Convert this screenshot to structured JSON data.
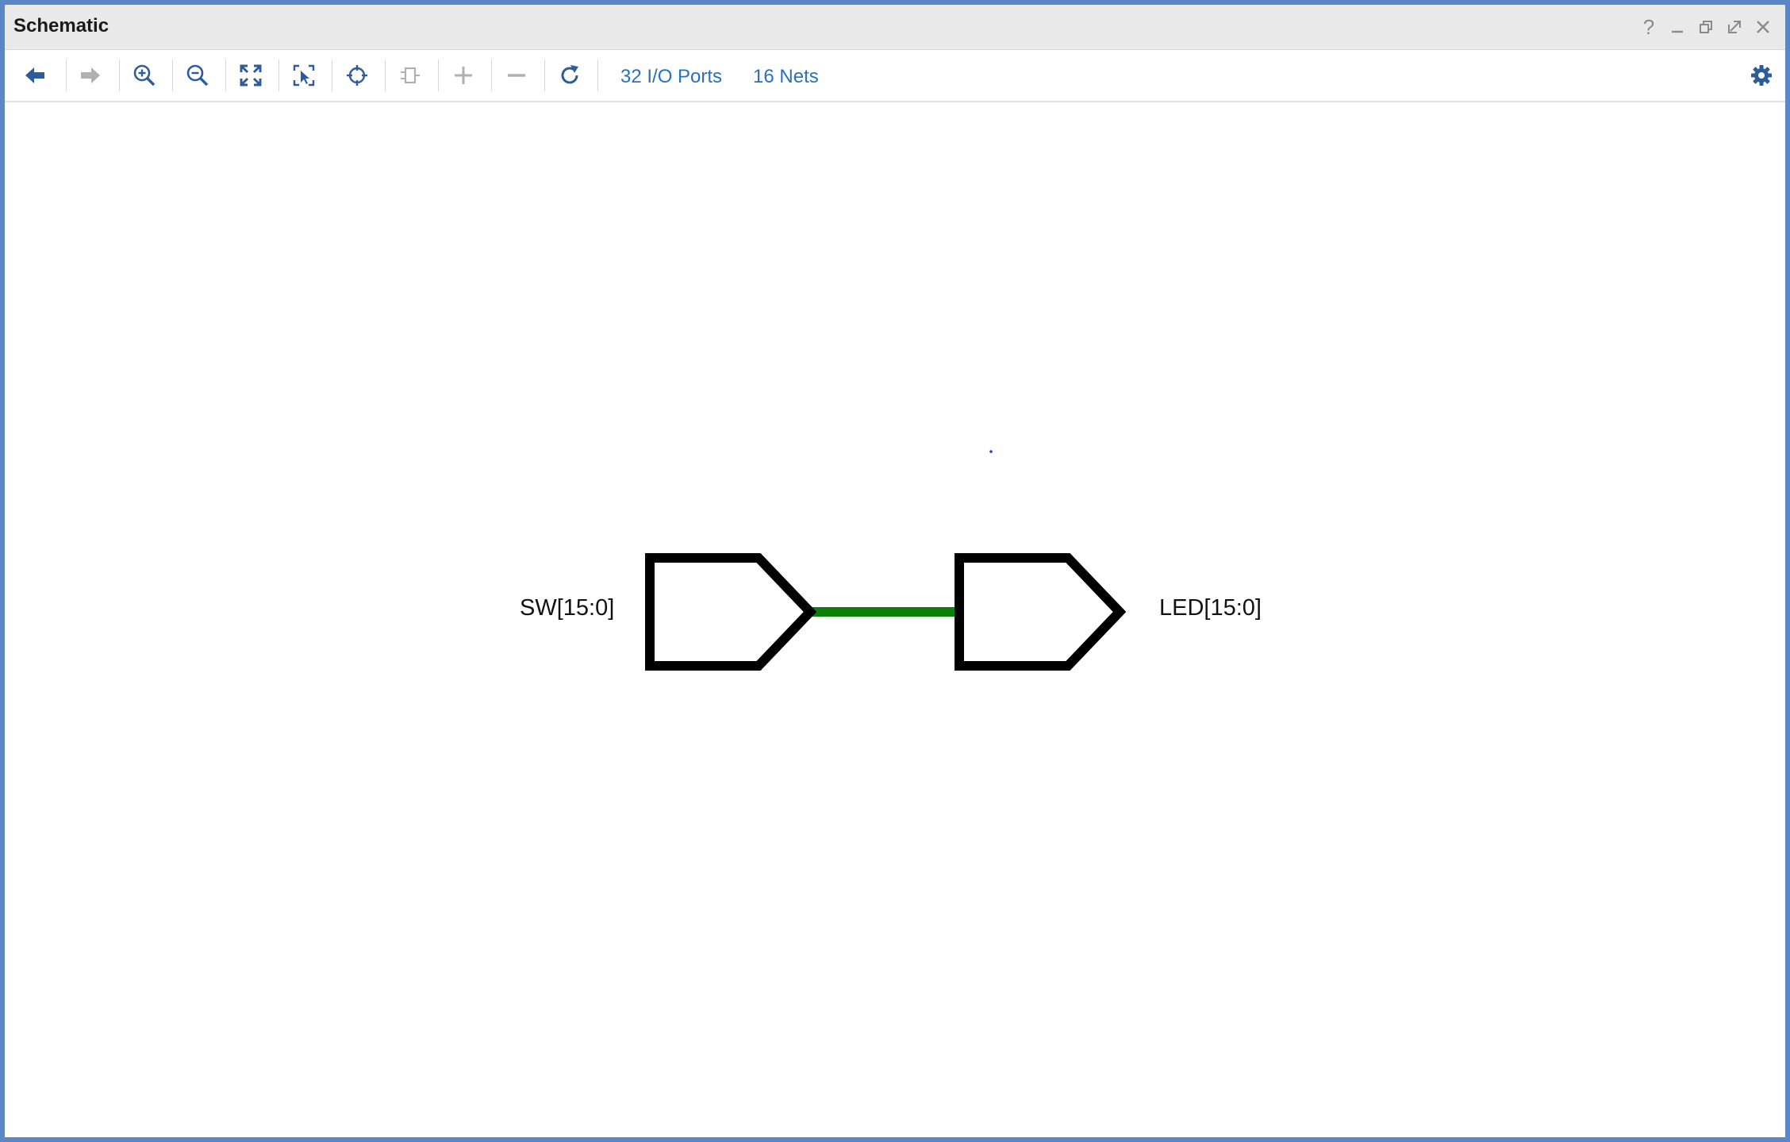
{
  "window": {
    "title": "Schematic",
    "controls": [
      "help-icon",
      "minimize-icon",
      "restore-icon",
      "float-icon",
      "close-icon"
    ],
    "border_color": "#5b87c7"
  },
  "toolbar": {
    "buttons": [
      {
        "name": "back-button",
        "icon": "arrow-left-icon",
        "enabled": true
      },
      {
        "name": "forward-button",
        "icon": "arrow-right-icon",
        "enabled": false
      },
      {
        "name": "zoom-in-button",
        "icon": "zoom-in-icon",
        "enabled": true
      },
      {
        "name": "zoom-out-button",
        "icon": "zoom-out-icon",
        "enabled": true
      },
      {
        "name": "zoom-fit-button",
        "icon": "fit-icon",
        "enabled": true
      },
      {
        "name": "zoom-area-button",
        "icon": "zoom-area-icon",
        "enabled": true
      },
      {
        "name": "auto-fit-selection-button",
        "icon": "crosshair-icon",
        "enabled": true
      },
      {
        "name": "toggle-cell-button",
        "icon": "cell-icon",
        "enabled": false
      },
      {
        "name": "expand-button",
        "icon": "plus-icon",
        "enabled": false
      },
      {
        "name": "collapse-button",
        "icon": "minus-icon",
        "enabled": false
      },
      {
        "name": "regenerate-button",
        "icon": "refresh-icon",
        "enabled": true
      }
    ],
    "io_ports_label": "32 I/O Ports",
    "nets_label": "16 Nets",
    "settings_icon": "gear-icon",
    "icon_color": "#2e5c9a",
    "disabled_color": "#b0b0b0",
    "link_color": "#2a6fc0"
  },
  "schematic": {
    "input_port_label": "SW[15:0]",
    "output_port_label": "LED[15:0]",
    "net_color": "#0a7f0a",
    "port_color": "#000000"
  }
}
